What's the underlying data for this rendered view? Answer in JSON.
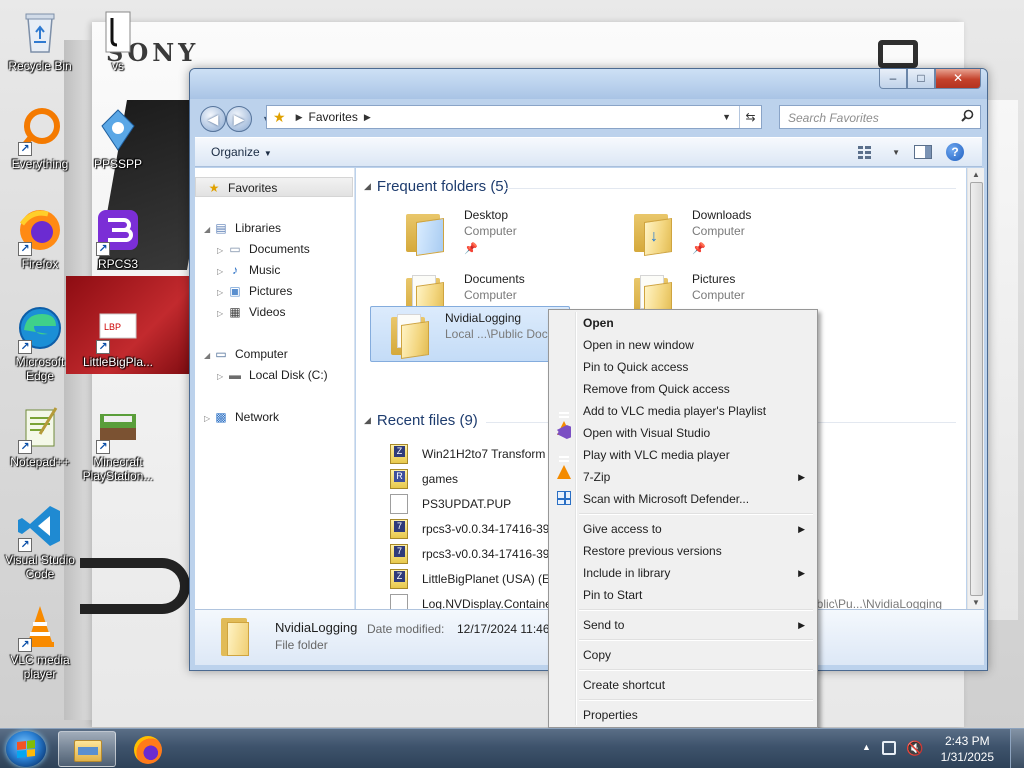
{
  "desktop": {
    "wallpaper_brand": "SONY",
    "icons": [
      {
        "name": "recycle-bin-icon",
        "label": "Recycle Bin"
      },
      {
        "name": "file-vs-icon",
        "label": "vs"
      },
      {
        "name": "everything-icon",
        "label": "Everything"
      },
      {
        "name": "ppsspp-icon",
        "label": "PPSSPP"
      },
      {
        "name": "firefox-icon",
        "label": "Firefox"
      },
      {
        "name": "rpcs3-icon",
        "label": "RPCS3"
      },
      {
        "name": "microsoft-edge-icon",
        "label": "Microsoft Edge"
      },
      {
        "name": "littlebigplanet-icon",
        "label": "LittleBigPla..."
      },
      {
        "name": "notepad-plus-plus-icon",
        "label": "Notepad++"
      },
      {
        "name": "minecraft-icon",
        "label": "Minecraft PlayStation..."
      },
      {
        "name": "visual-studio-code-icon",
        "label": "Visual Studio Code"
      },
      {
        "name": "vlc-icon",
        "label": "VLC media player"
      }
    ]
  },
  "window": {
    "caption": {
      "minimize": "–",
      "maximize": "□",
      "close": "✕"
    },
    "address": {
      "crumb": "Favorites"
    },
    "search": {
      "placeholder": "Search Favorites"
    },
    "toolbar": {
      "organize": "Organize"
    },
    "nav": {
      "favorites": "Favorites",
      "libraries": "Libraries",
      "documents": "Documents",
      "music": "Music",
      "pictures": "Pictures",
      "videos": "Videos",
      "computer": "Computer",
      "local_disk": "Local Disk (C:)",
      "network": "Network"
    },
    "frequent": {
      "header": "Frequent folders (5)",
      "tiles": [
        {
          "name": "Desktop",
          "sub": "Computer"
        },
        {
          "name": "Downloads",
          "sub": "Computer"
        },
        {
          "name": "Documents",
          "sub": "Computer"
        },
        {
          "name": "Pictures",
          "sub": "Computer"
        },
        {
          "name": "NvidiaLogging",
          "sub": "Local ...\\Public Doc"
        }
      ]
    },
    "recent": {
      "header": "Recent files (9)",
      "files": [
        {
          "name": "Win21H2to7 Transform",
          "type": "zip"
        },
        {
          "name": "games",
          "type": "zip-r"
        },
        {
          "name": "PS3UPDAT.PUP",
          "type": "doc"
        },
        {
          "name": "rpcs3-v0.0.34-17416-394",
          "type": "zip7"
        },
        {
          "name": "rpcs3-v0.0.34-17416-394",
          "type": "zip7"
        },
        {
          "name": "LittleBigPlanet (USA) (En",
          "type": "zip"
        },
        {
          "name": "Log.NVDisplay.Containe",
          "type": "doc",
          "location": "ublic\\Pu...\\NvidiaLogging"
        }
      ]
    },
    "details": {
      "name": "NvidiaLogging",
      "type": "File folder",
      "modified_label": "Date modified:",
      "modified_value": "12/17/2024 11:46"
    }
  },
  "context_menu": {
    "items": [
      {
        "label": "Open",
        "bold": true
      },
      {
        "label": "Open in new window"
      },
      {
        "label": "Pin to Quick access"
      },
      {
        "label": "Remove from Quick access"
      },
      {
        "label": "Add to VLC media player's Playlist",
        "icon": "vlc"
      },
      {
        "label": "Open with Visual Studio",
        "icon": "vs"
      },
      {
        "label": "Play with VLC media player",
        "icon": "vlc"
      },
      {
        "label": "7-Zip",
        "submenu": true
      },
      {
        "label": "Scan with Microsoft Defender...",
        "icon": "defender"
      },
      {
        "label": "Give access to",
        "submenu": true
      },
      {
        "label": "Restore previous versions"
      },
      {
        "label": "Include in library",
        "submenu": true
      },
      {
        "label": "Pin to Start"
      },
      {
        "label": "Send to",
        "submenu": true
      },
      {
        "label": "Copy"
      },
      {
        "label": "Create shortcut"
      },
      {
        "label": "Properties"
      }
    ]
  },
  "taskbar": {
    "time": "2:43 PM",
    "date": "1/31/2025"
  }
}
